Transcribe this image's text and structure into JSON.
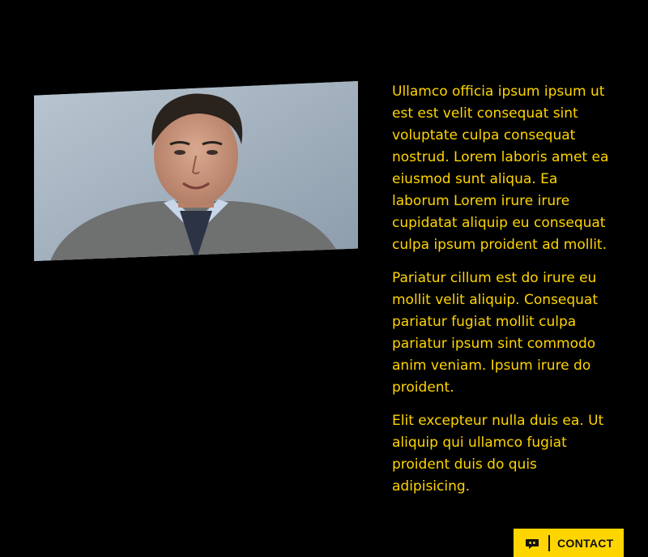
{
  "paragraphs": [
    "Ullamco officia ipsum ipsum ut est est velit consequat sint voluptate culpa consequat nostrud. Lorem laboris amet ea eiusmod sunt aliqua. Ea laborum Lorem irure irure cupidatat aliquip eu consequat culpa ipsum proident ad mollit.",
    "Pariatur cillum est do irure eu mollit velit aliquip. Consequat pariatur fugiat mollit culpa pariatur ipsum sint commodo anim veniam. Ipsum irure do proident.",
    "Elit excepteur nulla duis ea. Ut aliquip qui ullamco fugiat proident duis do quis adipisicing."
  ],
  "contact": {
    "label": "CONTACT",
    "icon": "chat-bubble-icon"
  },
  "colors": {
    "background": "#000000",
    "accent": "#ffd500"
  }
}
